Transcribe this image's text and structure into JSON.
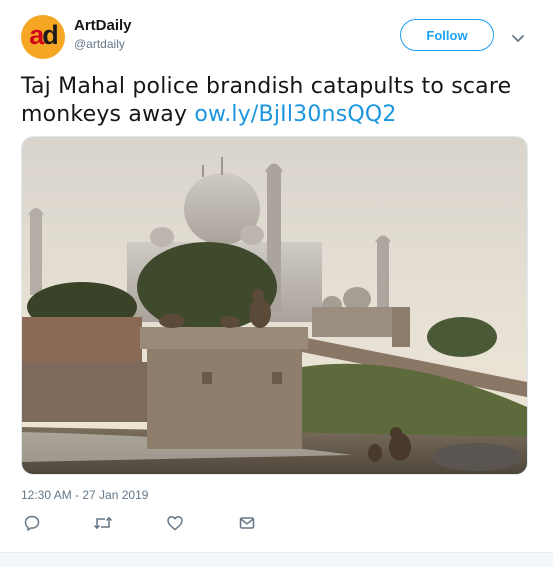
{
  "account": {
    "display_name": "ArtDaily",
    "handle": "@artdaily",
    "avatar_text_a": "a",
    "avatar_text_d": "d",
    "avatar_bg": "#f5a623"
  },
  "follow_button": {
    "label": "Follow"
  },
  "tweet": {
    "text": "Taj Mahal police brandish catapults to scare monkeys away ",
    "link": "ow.ly/BjIl30nsQQ2"
  },
  "timestamp": "12:30 AM - 27 Jan 2019",
  "actions": [
    {
      "icon": "reply-icon"
    },
    {
      "icon": "retweet-icon"
    },
    {
      "icon": "like-icon"
    },
    {
      "icon": "direct-message-icon"
    }
  ],
  "colors": {
    "accent": "#1da1f2",
    "link": "#1b95e0",
    "muted": "#657786"
  }
}
